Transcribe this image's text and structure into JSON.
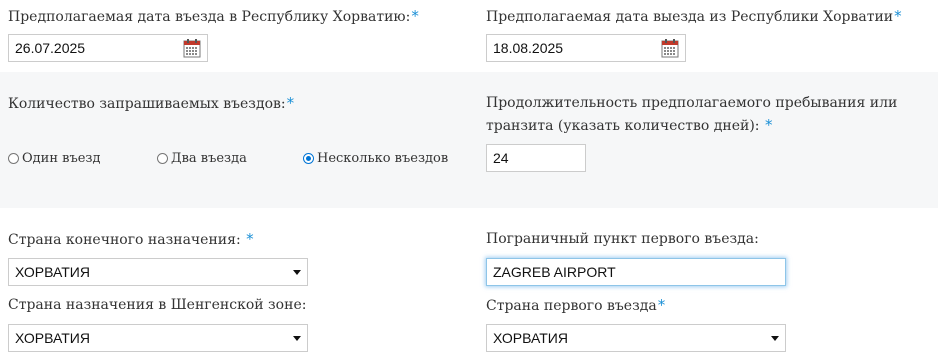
{
  "entry_date": {
    "label": "Предполагаемая дата въезда в Республику Хорватию:",
    "required_mark": "*",
    "value": "26.07.2025",
    "icon": "calendar-icon"
  },
  "exit_date": {
    "label": "Предполагаемая дата выезда из Республики Хорватии",
    "required_mark": "*",
    "value": "18.08.2025",
    "icon": "calendar-icon"
  },
  "entries": {
    "label": "Количество запрашиваемых въездов:",
    "required_mark": "*",
    "options": [
      {
        "label": "Один въезд",
        "checked": false
      },
      {
        "label": "Два въезда",
        "checked": false
      },
      {
        "label": "Несколько въездов",
        "checked": true
      }
    ]
  },
  "duration": {
    "label": "Продолжительность предполагаемого пребывания или транзита (указать количество дней):",
    "required_mark": "*",
    "value": "24"
  },
  "final_destination": {
    "label": "Страна конечного назначения:",
    "required_mark": "*",
    "value": "ХОРВАТИЯ"
  },
  "border_point": {
    "label": "Пограничный пункт первого въезда:",
    "value": "ZAGREB AIRPORT"
  },
  "schengen_destination": {
    "label": "Страна назначения в Шенгенской зоне:",
    "value": "ХОРВАТИЯ"
  },
  "first_entry_country": {
    "label": "Страна первого въезда",
    "required_mark": "*",
    "value": "ХОРВАТИЯ"
  },
  "colors": {
    "required_mark": "#1a8fd6",
    "radio_checked": "#0075d6",
    "band_gray": "#f6f7f8"
  }
}
